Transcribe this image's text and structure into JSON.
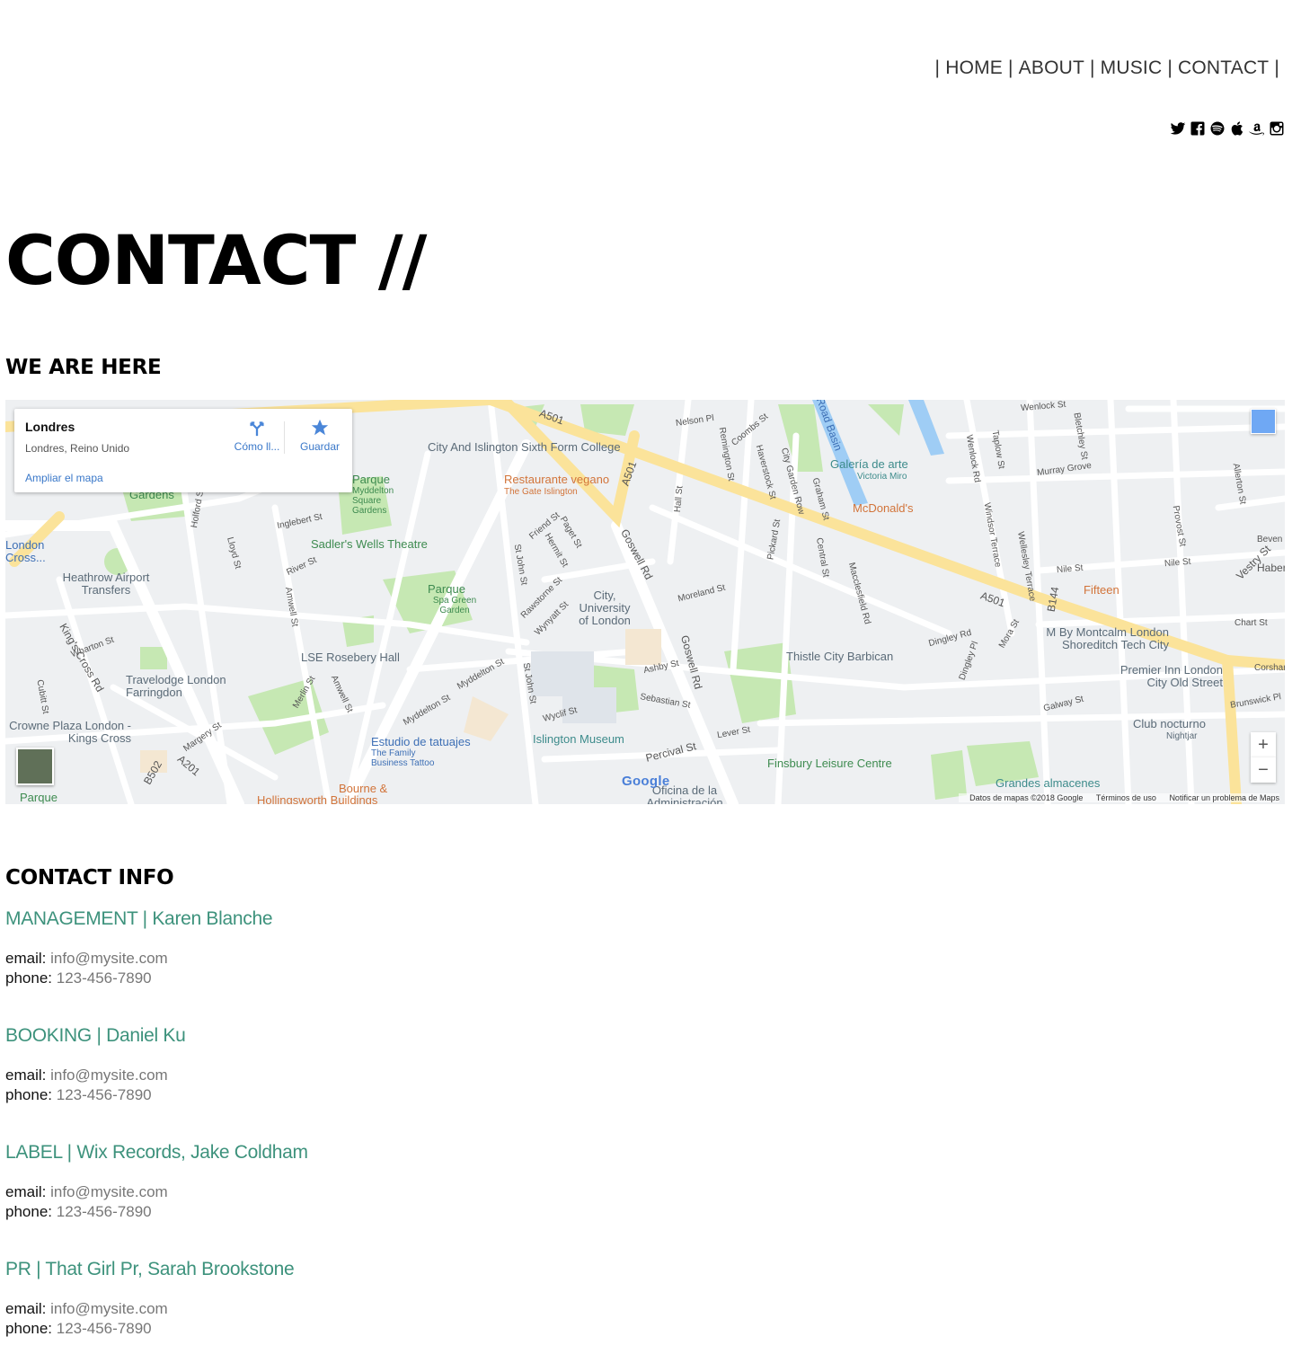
{
  "nav": {
    "items": [
      "HOME",
      "ABOUT",
      "MUSIC",
      "CONTACT"
    ],
    "separator": "|"
  },
  "social": [
    "twitter-icon",
    "facebook-icon",
    "spotify-icon",
    "apple-icon",
    "amazon-icon",
    "instagram-icon"
  ],
  "page": {
    "title": "CONTACT //",
    "map_heading": "WE ARE HERE",
    "contact_heading": "CONTACT INFO"
  },
  "map": {
    "card": {
      "title": "Londres",
      "subtitle": "Londres, Reino Unido",
      "enlarge": "Ampliar el mapa",
      "directions": "Cómo ll...",
      "save": "Guardar"
    },
    "zoom_in": "+",
    "zoom_out": "−",
    "google": "Google",
    "attribution": {
      "data": "Datos de mapas ©2018 Google",
      "terms": "Términos de uso",
      "report": "Notificar un problema de Maps"
    },
    "labels": {
      "a501a": "A501",
      "a501b": "A501",
      "a501c": "A501",
      "goswell": "Goswell Rd",
      "goswell2": "Goswell Rd",
      "percival": "Percival St",
      "moreland": "Moreland St",
      "lever": "Lever St",
      "galway": "Galway St",
      "kingscross": "King's Cross Rd",
      "b144": "B144",
      "b502": "B502",
      "a201": "A201",
      "rosebery": "LSE Rosebery Hall",
      "sadlers": "Sadler's Wells Theatre",
      "cityuni": "City, University of London",
      "islington_museum": "Islington Museum",
      "finsbury": "Finsbury Leisure Centre",
      "thistle": "Thistle City Barbican",
      "mcd": "McDonald's",
      "galeria": "Galería de arte",
      "galeria_sub": "Victoria Miro",
      "fifteen": "Fifteen",
      "montcalm": "M By Montcalm London Shoreditch Tech City",
      "premier": "Premier Inn London City Old Street",
      "club": "Club nocturno",
      "club_sub": "Nightjar",
      "heathrow": "Heathrow Airport Transfers",
      "travelodge": "Travelodge London Farringdon",
      "crowne": "Crowne Plaza London - Kings Cross",
      "tatuajes": "Estudio de tatuajes",
      "tatuajes_sub": "The Family Business Tattoo",
      "restaurante": "Restaurante vegano",
      "restaurante_sub": "The Gate Islington",
      "college": "City And Islington Sixth Form College",
      "parque_square": "Parque",
      "parque_square_sub": "Myddelton Square Gardens",
      "parque_spa": "Parque",
      "parque_spa_sub": "Spa Green Garden",
      "gardens": "Gardens",
      "london_cross": "London Cross...",
      "parque_bottom": "Parque",
      "bourne": "Bourne &",
      "hollingsworth": "Hollingsworth Buildings",
      "grandes": "Grandes almacenes",
      "oficina": "Oficina de la Administración",
      "road_basin": "Road Basin",
      "wenlock": "Wenlock St",
      "murray": "Murray Grove",
      "nile": "Nile St",
      "chart": "Chart St",
      "vestry": "Vestry St",
      "brunswick": "Brunswick Pl",
      "haberdasher": "Haber",
      "bevenden": "Beven",
      "corsham": "Corshar",
      "sebastian": "Sebastian St",
      "ashby": "Ashby St",
      "wyclif": "Wyclif St",
      "myddelton": "Myddelton St",
      "whartonst": "Wharton St",
      "margery": "Margery St",
      "merlin": "Merlin St",
      "amwell": "Amwell St",
      "riverst": "River St",
      "lloyd": "Lloyd St",
      "inglebert": "Inglebert St",
      "holford": "Holford St",
      "rawstorne": "Rawstorne St",
      "wynyatt": "Wynyatt St",
      "stjohn": "St John St",
      "friend": "Friend St",
      "hermit": "Hermit St",
      "paget": "Paget St",
      "hall": "Hall St",
      "nelson": "Nelson Pl",
      "remington": "Remington St",
      "coombs": "Coombs St",
      "haverstock": "Haverstock St",
      "citygarden": "City Garden Row",
      "graham": "Graham St",
      "pickard": "Pickard St",
      "central": "Central St",
      "macclesfield": "Macclesfield Rd",
      "windsor": "Windsor Terrace",
      "wellesley": "Wellesley Terrace",
      "wenlockrd": "Wenlock Rd",
      "taplow": "Taplow St",
      "bletchley": "Bletchley St",
      "provost": "Provost St",
      "allerton": "Allerton St",
      "dingley": "Dingley Rd",
      "dingleypl": "Dingley Pl",
      "mora": "Mora St",
      "cubitt": "Cubitt St"
    }
  },
  "contacts": [
    {
      "role": "MANAGEMENT | Karen Blanche",
      "email_label": "email:",
      "email": "info@mysite.com",
      "phone_label": "phone:",
      "phone": "123-456-7890"
    },
    {
      "role": "BOOKING | Daniel Ku",
      "email_label": "email:",
      "email": "info@mysite.com",
      "phone_label": "phone:",
      "phone": "123-456-7890"
    },
    {
      "role": "LABEL | Wix Records, Jake Coldham",
      "email_label": "email:",
      "email": "info@mysite.com",
      "phone_label": "phone:",
      "phone": "123-456-7890"
    },
    {
      "role": "PR | That Girl Pr, Sarah Brookstone",
      "email_label": "email:",
      "email": "info@mysite.com",
      "phone_label": "phone:",
      "phone": "123-456-7890"
    }
  ],
  "colors": {
    "accent": "#3d927c",
    "map_road_major": "#fbe39a",
    "map_park": "#c6e8b3",
    "map_water": "#9fcdf5"
  }
}
